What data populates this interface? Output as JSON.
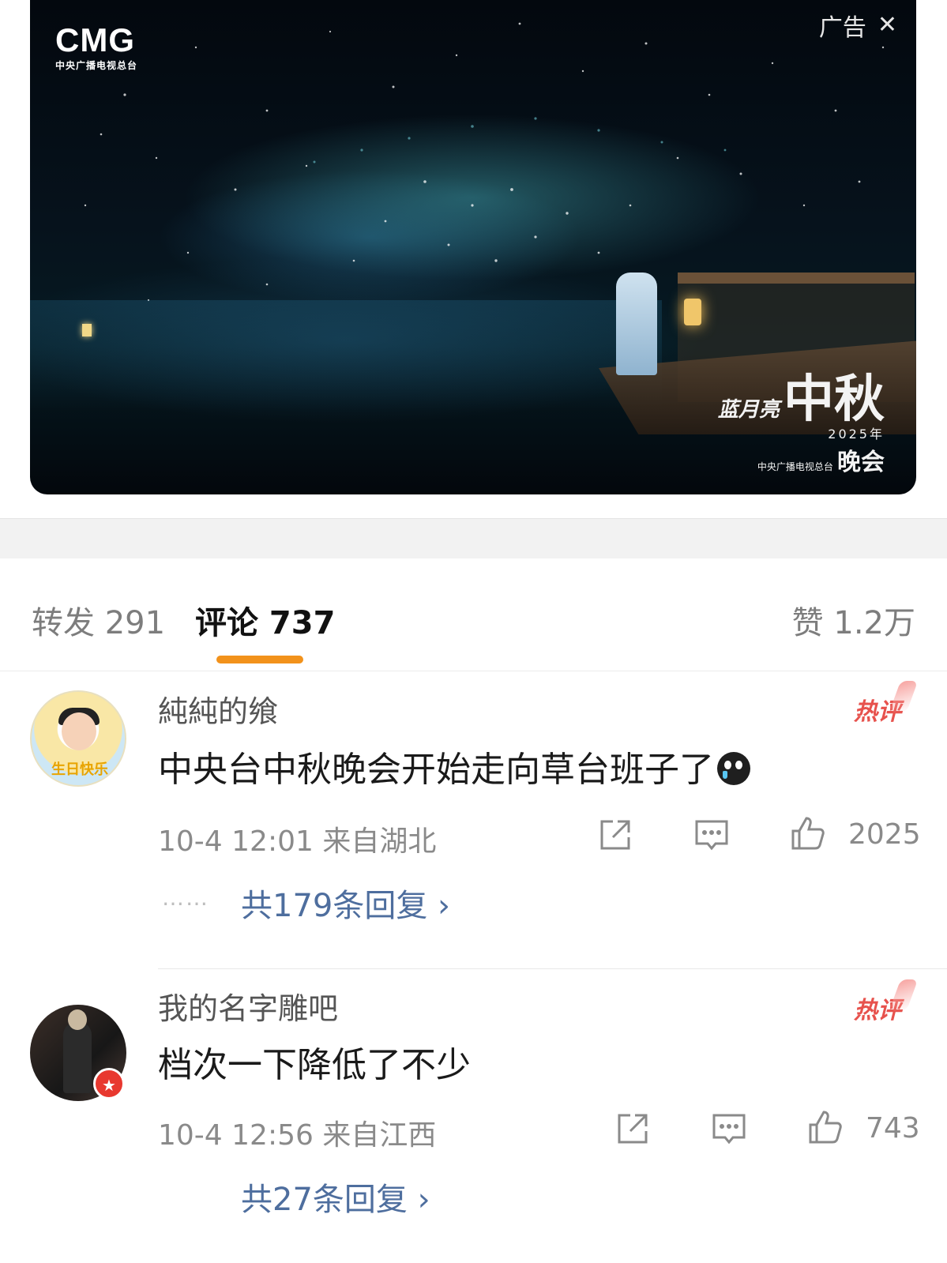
{
  "video": {
    "logo_main": "CMG",
    "logo_sub": "中央广播电视总台",
    "ad_label": "广告",
    "gala_brand": "蓝月亮",
    "gala_title_main": "中秋",
    "gala_year": "2025年",
    "gala_org": "中央广播电视总台",
    "gala_title_sub": "晚会"
  },
  "tabs": {
    "repost": "转发 291",
    "comments": "评论 737",
    "likes": "赞 1.2万",
    "active_color": "#f2921b"
  },
  "comments": [
    {
      "username": "純純的飨",
      "hot_tag": "热评",
      "text": "中央台中秋晚会开始走向草台班子了",
      "time_location": "10-4 12:01  来自湖北",
      "like_count": "2025",
      "reply_dots": "……",
      "replies_label": "共179条回复 ›",
      "avatar_text": "生日快乐"
    },
    {
      "username": "我的名字雕吧",
      "hot_tag": "热评",
      "text": "档次一下降低了不少",
      "time_location": "10-4 12:56  来自江西",
      "like_count": "743",
      "replies_label": "共27条回复 ›"
    }
  ],
  "colors": {
    "hot": "#e7524d",
    "reply_link": "#4e6e9e"
  }
}
